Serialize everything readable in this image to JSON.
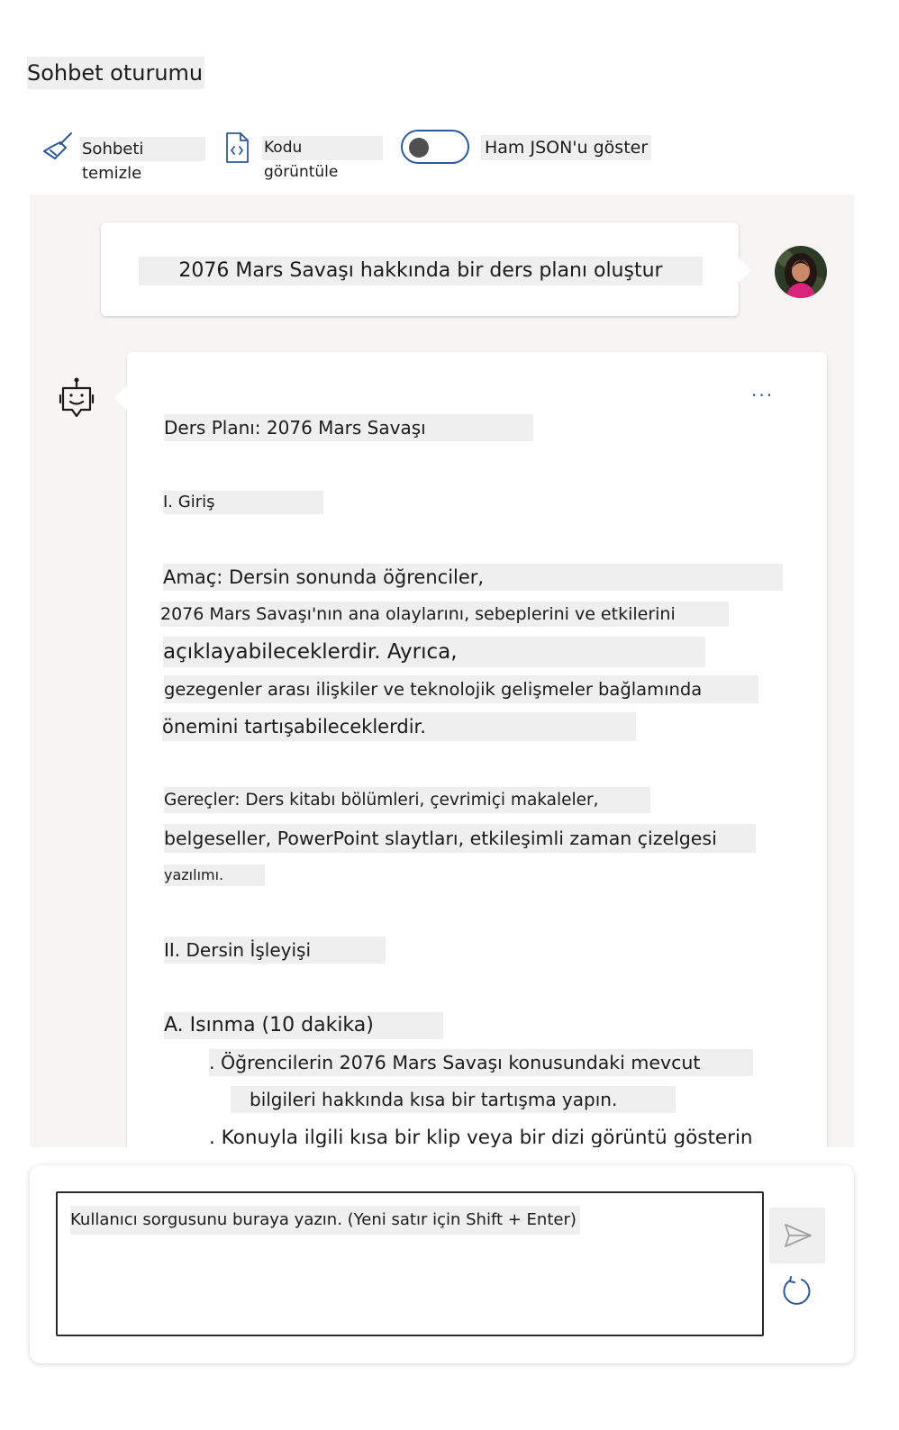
{
  "page": {
    "title": "Sohbet oturumu"
  },
  "toolbar": {
    "clear_label": "Sohbeti temizle",
    "view_code_label": "Kodu görüntüle",
    "raw_json_label": "Ham JSON'u göster",
    "raw_json_toggle_on": false
  },
  "chat": {
    "user_message": "2076 Mars Savaşı hakkında bir ders planı oluştur",
    "more_label": "...",
    "assistant_lines": [
      "Ders Planı: 2076 Mars Savaşı",
      "I. Giriş",
      "Amaç: Dersin sonunda öğrenciler,",
      "2076 Mars Savaşı'nın ana olaylarını, sebeplerini ve etkilerini",
      "açıklayabileceklerdir. Ayrıca,",
      "gezegenler arası ilişkiler ve teknolojik gelişmeler bağlamında",
      "önemini tartışabileceklerdir.",
      "Gereçler: Ders kitabı bölümleri, çevrimiçi makaleler,",
      "belgeseller, PowerPoint slaytları, etkileşimli zaman çizelgesi",
      "yazılımı.",
      "II. Dersin İşleyişi",
      "A. Isınma (10 dakika)",
      ". Öğrencilerin 2076 Mars Savaşı konusundaki mevcut",
      "bilgileri hakkında kısa bir tartışma yapın.",
      ". Konuyla ilgili kısa bir klip veya bir dizi görüntü gösterin"
    ]
  },
  "input": {
    "placeholder": "Kullanıcı sorgusunu buraya yazın. (Yeni satır için Shift + Enter)"
  },
  "colors": {
    "accent": "#2b5a9e",
    "chat_bg": "#f6f5f4",
    "text_highlight": "#efefef"
  },
  "icons": {
    "clear": "broom-icon",
    "code": "code-file-icon",
    "assistant": "bot-icon",
    "send": "send-icon",
    "refresh": "refresh-icon"
  }
}
